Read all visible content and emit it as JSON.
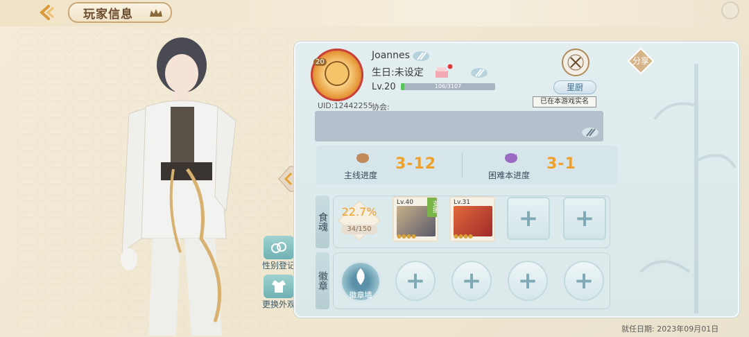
{
  "header": {
    "title": "玩家信息"
  },
  "profile": {
    "avatar_level": "20",
    "name": "Joannes",
    "birthday": "生日:未设定",
    "level": "Lv.20",
    "exp": "106/3107",
    "exp_progress": 0.034,
    "uid": "UID:12442255",
    "guild": "协会:"
  },
  "kitchen": {
    "label": "里厨",
    "realname": "已在本游戏实名"
  },
  "share": {
    "label": "分享"
  },
  "progress": {
    "main_label": "主线进度",
    "main_value": "3-12",
    "hard_label": "困难本进度",
    "hard_value": "3-1"
  },
  "food_soul": {
    "tab": "食魂",
    "percent": "22.7%",
    "count": "34/150",
    "cards": [
      {
        "level": "Lv.40",
        "assist": "支援"
      },
      {
        "level": "Lv.31"
      }
    ]
  },
  "badge": {
    "tab": "徽章",
    "wall_label": "徽章墙"
  },
  "side": {
    "gender_label": "性别登记",
    "outfit_label": "更换外观"
  },
  "appointment": "就任日期:  2023年09月01日",
  "colors": {
    "accent": "#f0a029",
    "panel": "#dbe8ea",
    "exp": "#5ac25a"
  }
}
